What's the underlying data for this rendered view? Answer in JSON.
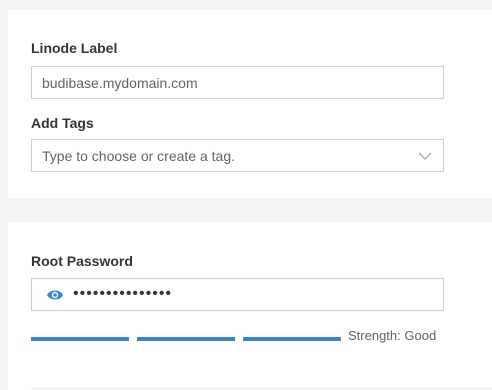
{
  "linode_label": {
    "label": "Linode Label",
    "value": "budibase.mydomain.com"
  },
  "tags": {
    "label": "Add Tags",
    "placeholder": "Type to choose or create a tag."
  },
  "root_password": {
    "label": "Root Password",
    "masked_value": "•••••••••••••••",
    "strength_text": "Strength: Good",
    "strength_filled_segments": 3,
    "strength_total_segments": 3
  },
  "colors": {
    "accent": "#3683dc",
    "border": "#ccd0d5",
    "page_background": "#f4f5f6"
  },
  "icons": {
    "eye": "eye-icon",
    "chevron": "chevron-down-icon"
  }
}
